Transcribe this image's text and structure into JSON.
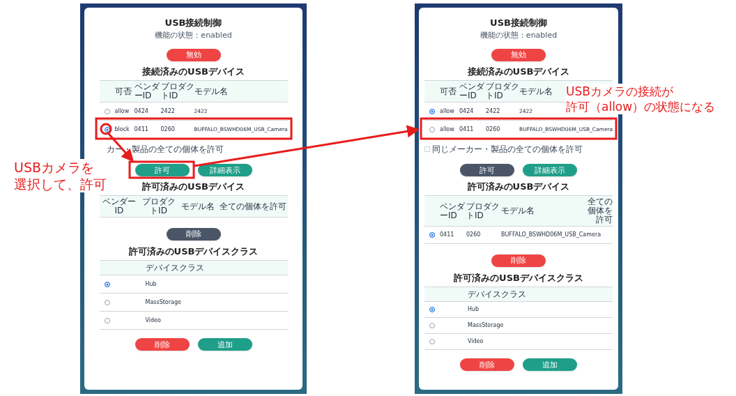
{
  "panels": [
    {
      "title": "USB接続制御",
      "status": "機能の状態：enabled",
      "toggle_button": {
        "label": "無効",
        "kind": "danger"
      },
      "connected": {
        "heading": "接続済みのUSBデバイス",
        "columns": [
          "可否",
          "ベンダーID",
          "プロダクトID",
          "モデル名"
        ],
        "rows": [
          {
            "selected": false,
            "cells": [
              "allow",
              "0424",
              "2422",
              "2422"
            ]
          },
          {
            "selected": true,
            "cells": [
              "block",
              "0411",
              "0260",
              "BUFFALO_BSWHD06M_USB_Camera"
            ]
          }
        ]
      },
      "same_maker": {
        "label": "カー・製品の全ての個体を許可"
      },
      "action_buttons": [
        {
          "label": "許可",
          "kind": "primary"
        },
        {
          "label": "詳細表示",
          "kind": "primary"
        }
      ],
      "allowed": {
        "heading": "許可済みのUSBデバイス",
        "columns": [
          "ベンダーID",
          "プロダクトID",
          "モデル名",
          "全ての個体を許可"
        ]
      },
      "allowed_button": {
        "label": "削除",
        "kind": "dark"
      },
      "classes": {
        "heading": "許可済みのUSBデバイスクラス",
        "column": "デバイスクラス",
        "rows": [
          {
            "selected": true,
            "name": "Hub"
          },
          {
            "selected": false,
            "name": "MassStorage"
          },
          {
            "selected": false,
            "name": "Video"
          }
        ]
      },
      "class_buttons": [
        {
          "label": "削除",
          "kind": "danger"
        },
        {
          "label": "追加",
          "kind": "primary"
        }
      ]
    },
    {
      "title": "USB接続制御",
      "status": "機能の状態：enabled",
      "toggle_button": {
        "label": "無効",
        "kind": "danger"
      },
      "connected": {
        "heading": "接続済みのUSBデバイス",
        "columns": [
          "可否",
          "ベンダーID",
          "プロダクトID",
          "モデル名"
        ],
        "rows": [
          {
            "selected": true,
            "cells": [
              "allow",
              "0424",
              "2422",
              "2422"
            ]
          },
          {
            "selected": false,
            "cells": [
              "allow",
              "0411",
              "0260",
              "BUFFALO_BSWHD06M_USB_Camera"
            ]
          }
        ]
      },
      "same_maker": {
        "label": "同じメーカー・製品の全ての個体を許可",
        "checked": false
      },
      "action_buttons": [
        {
          "label": "許可",
          "kind": "dark"
        },
        {
          "label": "詳細表示",
          "kind": "primary"
        }
      ],
      "allowed": {
        "heading": "許可済みのUSBデバイス",
        "columns": [
          "ベンダーID",
          "プロダクトID",
          "モデル名",
          "全ての個体を許可"
        ],
        "rows": [
          {
            "selected": true,
            "cells": [
              "0411",
              "0260",
              "BUFFALO_BSWHD06M_USB_Camera"
            ]
          }
        ]
      },
      "allowed_button": {
        "label": "削除",
        "kind": "danger"
      },
      "classes": {
        "heading": "許可済みのUSBデバイスクラス",
        "column": "デバイスクラス",
        "rows": [
          {
            "selected": true,
            "name": "Hub"
          },
          {
            "selected": false,
            "name": "MassStorage"
          },
          {
            "selected": false,
            "name": "Video"
          }
        ]
      },
      "class_buttons": [
        {
          "label": "削除",
          "kind": "danger"
        },
        {
          "label": "追加",
          "kind": "primary"
        }
      ]
    }
  ],
  "annotations": [
    {
      "lines": [
        "USBカメラを",
        "選択して、許可"
      ]
    },
    {
      "lines": [
        "USBカメラの接続が",
        "許可（allow）の状態になる"
      ]
    }
  ]
}
